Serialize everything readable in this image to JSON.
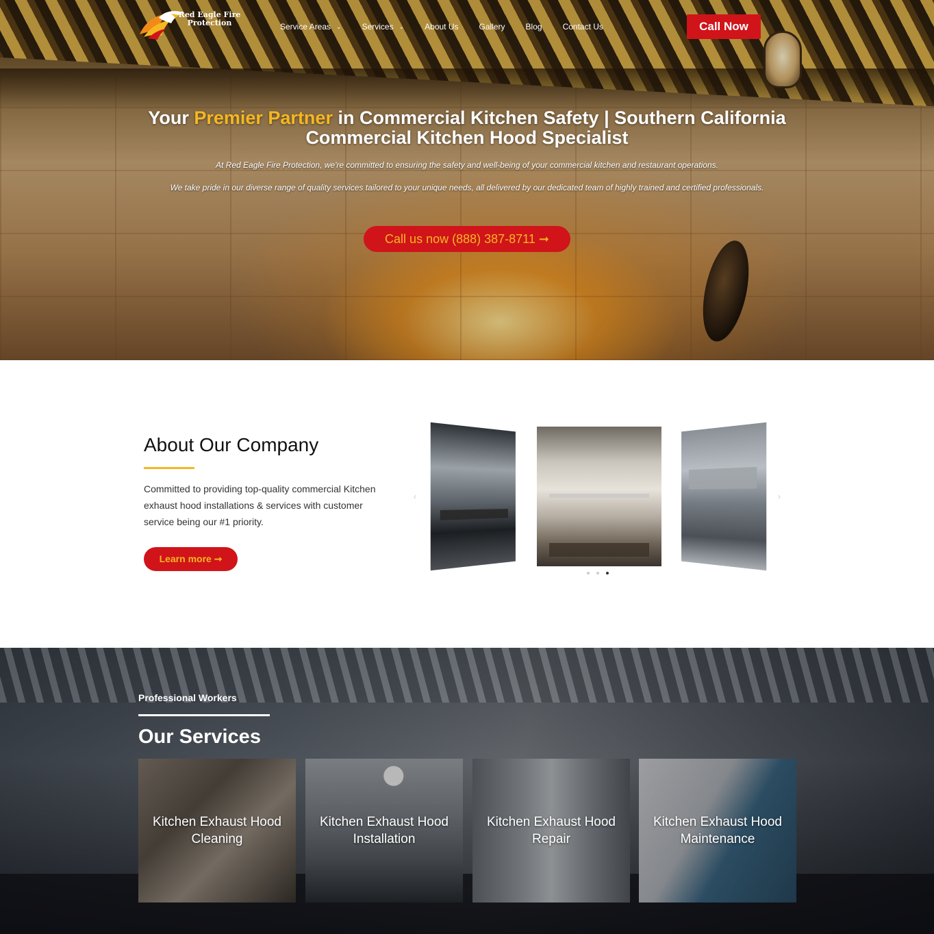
{
  "header": {
    "logo": {
      "name": "Red Eagle Fire Protection",
      "icon": "eagle-flame-logo-icon"
    },
    "nav": [
      {
        "label": "Service Areas",
        "has_dropdown": true
      },
      {
        "label": "Services",
        "has_dropdown": true
      },
      {
        "label": "About Us",
        "has_dropdown": false
      },
      {
        "label": "Gallery",
        "has_dropdown": false
      },
      {
        "label": "Blog",
        "has_dropdown": false
      },
      {
        "label": "Contact Us",
        "has_dropdown": false
      }
    ],
    "call_now_label": "Call Now"
  },
  "hero": {
    "title_prefix": "Your ",
    "title_highlight": "Premier Partner",
    "title_suffix": " in Commercial Kitchen Safety | Southern California Commercial Kitchen Hood Specialist",
    "paragraph_1": "At Red Eagle Fire Protection, we're committed to ensuring the safety and well-being of your commercial kitchen and restaurant operations.",
    "paragraph_2": "We take pride in our diverse range of quality services tailored to your unique needs, all delivered by our dedicated team of highly trained and certified professionals.",
    "cta_label": "Call us now (888) 387-8711 ➞"
  },
  "about": {
    "title": "About Our Company",
    "text": "Committed to providing top-quality commercial Kitchen exhaust hood installations & services with customer service being our #1 priority.",
    "button_label": "Learn more ➞",
    "carousel": {
      "prev_icon": "‹",
      "next_icon": "›",
      "slide_count": 3,
      "active_dot": 3
    }
  },
  "services": {
    "kicker": "Professional Workers",
    "title": "Our Services",
    "cards": [
      {
        "label": "Kitchen Exhaust Hood Cleaning"
      },
      {
        "label": "Kitchen Exhaust Hood Installation"
      },
      {
        "label": "Kitchen Exhaust Hood Repair"
      },
      {
        "label": "Kitchen Exhaust Hood Maintenance"
      }
    ]
  },
  "colors": {
    "brand_red": "#d0141a",
    "accent_yellow": "#f5b821",
    "text_dark": "#111111"
  }
}
